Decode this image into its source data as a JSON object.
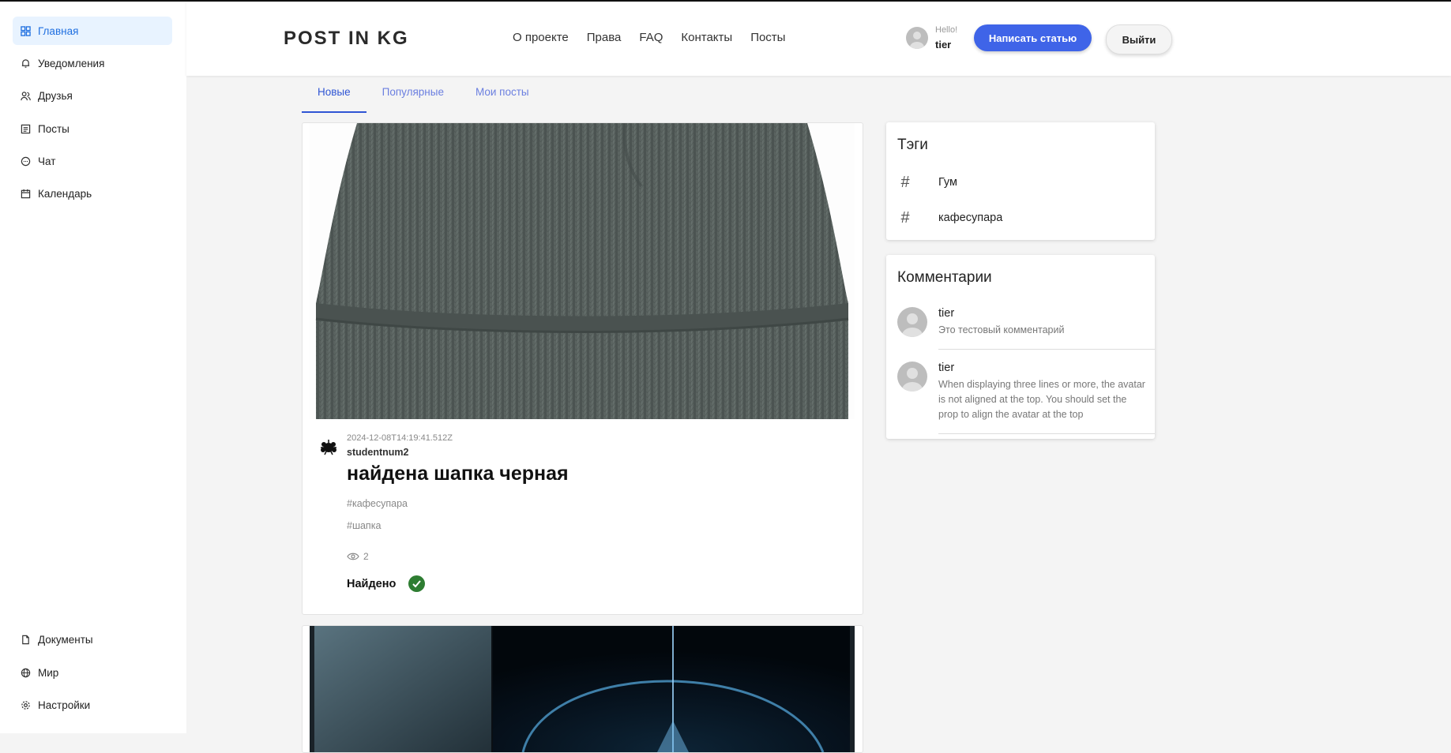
{
  "sidebar": {
    "items": [
      {
        "label": "Главная",
        "icon": "grid-icon",
        "active": true
      },
      {
        "label": "Уведомления",
        "icon": "bell-icon"
      },
      {
        "label": "Друзья",
        "icon": "friends-icon"
      },
      {
        "label": "Посты",
        "icon": "list-icon"
      },
      {
        "label": "Чат",
        "icon": "chat-icon"
      },
      {
        "label": "Календарь",
        "icon": "calendar-icon"
      }
    ],
    "bottom_items": [
      {
        "label": "Документы",
        "icon": "document-icon"
      },
      {
        "label": "Мир",
        "icon": "globe-icon"
      },
      {
        "label": "Настройки",
        "icon": "gear-icon"
      }
    ]
  },
  "header": {
    "logo": "POST IN KG",
    "menu": [
      "О проекте",
      "Права",
      "FAQ",
      "Контакты",
      "Посты"
    ],
    "hello": "Hello!",
    "username": "tier",
    "write_button": "Написать статью",
    "logout_button": "Выйти"
  },
  "tabs": [
    {
      "label": "Новые",
      "active": true
    },
    {
      "label": "Популярные"
    },
    {
      "label": "Мои посты"
    }
  ],
  "post": {
    "date": "2024-12-08T14:19:41.512Z",
    "author": "studentnum2",
    "title": "найдена шапка черная",
    "tags": [
      "#кафесупара",
      "#шапка"
    ],
    "views": "2",
    "status": "Найдено"
  },
  "tags_panel": {
    "title": "Тэги",
    "items": [
      "Гум",
      "кафесупара"
    ]
  },
  "comments_panel": {
    "title": "Комментарии",
    "items": [
      {
        "author": "tier",
        "text": "Это тестовый комментарий"
      },
      {
        "author": "tier",
        "text": "When displaying three lines or more, the avatar is not aligned at the top. You should set the prop to align the avatar at the top"
      }
    ]
  },
  "colors": {
    "accent": "#3f64e8",
    "active_nav_bg": "#e8f3ff",
    "found_green": "#2e7d32"
  }
}
